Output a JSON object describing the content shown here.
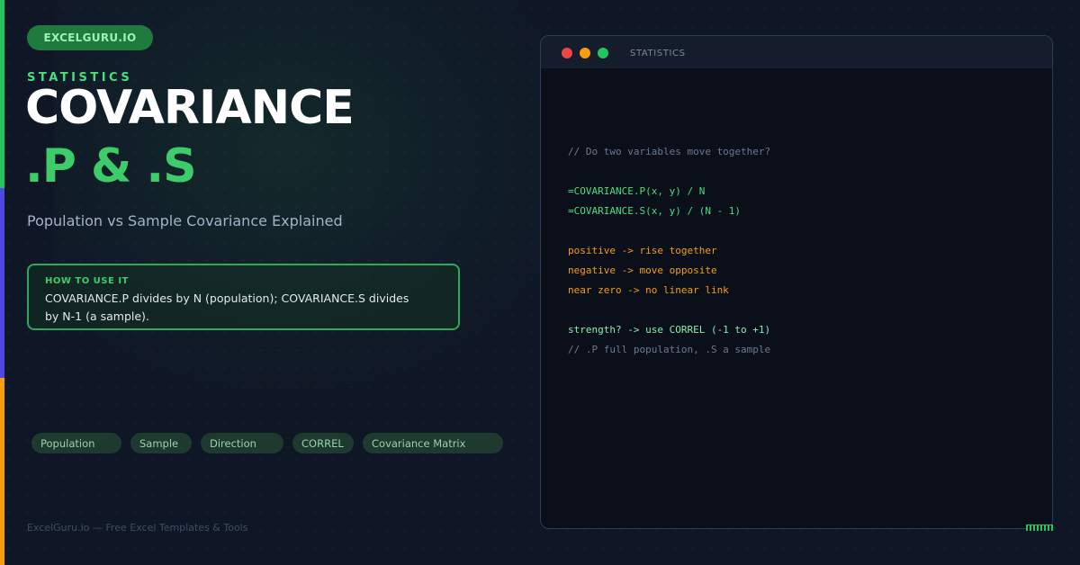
{
  "brand": {
    "label": "EXCELGURU.IO"
  },
  "hero": {
    "eyebrow": "STATISTICS",
    "title_line1": "COVARIANCE",
    "title_line2": ".P & .S",
    "subtitle": "Population vs Sample Covariance Explained"
  },
  "how_to": {
    "heading": "HOW TO USE IT",
    "body": "COVARIANCE.P divides by N (population); COVARIANCE.S divides by N-1 (a sample)."
  },
  "tags": [
    "Population",
    "Sample",
    "Direction",
    "CORREL",
    "Covariance Matrix"
  ],
  "footer": {
    "text": "ExcelGuru.io — Free Excel Templates & Tools"
  },
  "window": {
    "title": "STATISTICS",
    "code_lines": [
      {
        "text": "// Do two variables move together?",
        "style": "comment"
      },
      {
        "text": "",
        "style": "blank"
      },
      {
        "text": "=COVARIANCE.P(x, y) / N",
        "style": "formula"
      },
      {
        "text": "=COVARIANCE.S(x, y) / (N - 1)",
        "style": "formula"
      },
      {
        "text": "",
        "style": "blank"
      },
      {
        "text": "positive -> rise together",
        "style": "note"
      },
      {
        "text": "negative -> move opposite",
        "style": "note"
      },
      {
        "text": "near zero -> no linear link",
        "style": "note"
      },
      {
        "text": "",
        "style": "blank"
      },
      {
        "text": "strength? -> use CORREL (-1 to +1)",
        "style": "tip"
      },
      {
        "text": "// .P full population, .S a sample",
        "style": "comment"
      }
    ]
  },
  "colors": {
    "background": "#0f1626",
    "accent_green": "#3ecb6a",
    "accent_purple": "#4f46e5",
    "accent_orange": "#f59e0b",
    "window_bg": "#0a0f1a"
  }
}
